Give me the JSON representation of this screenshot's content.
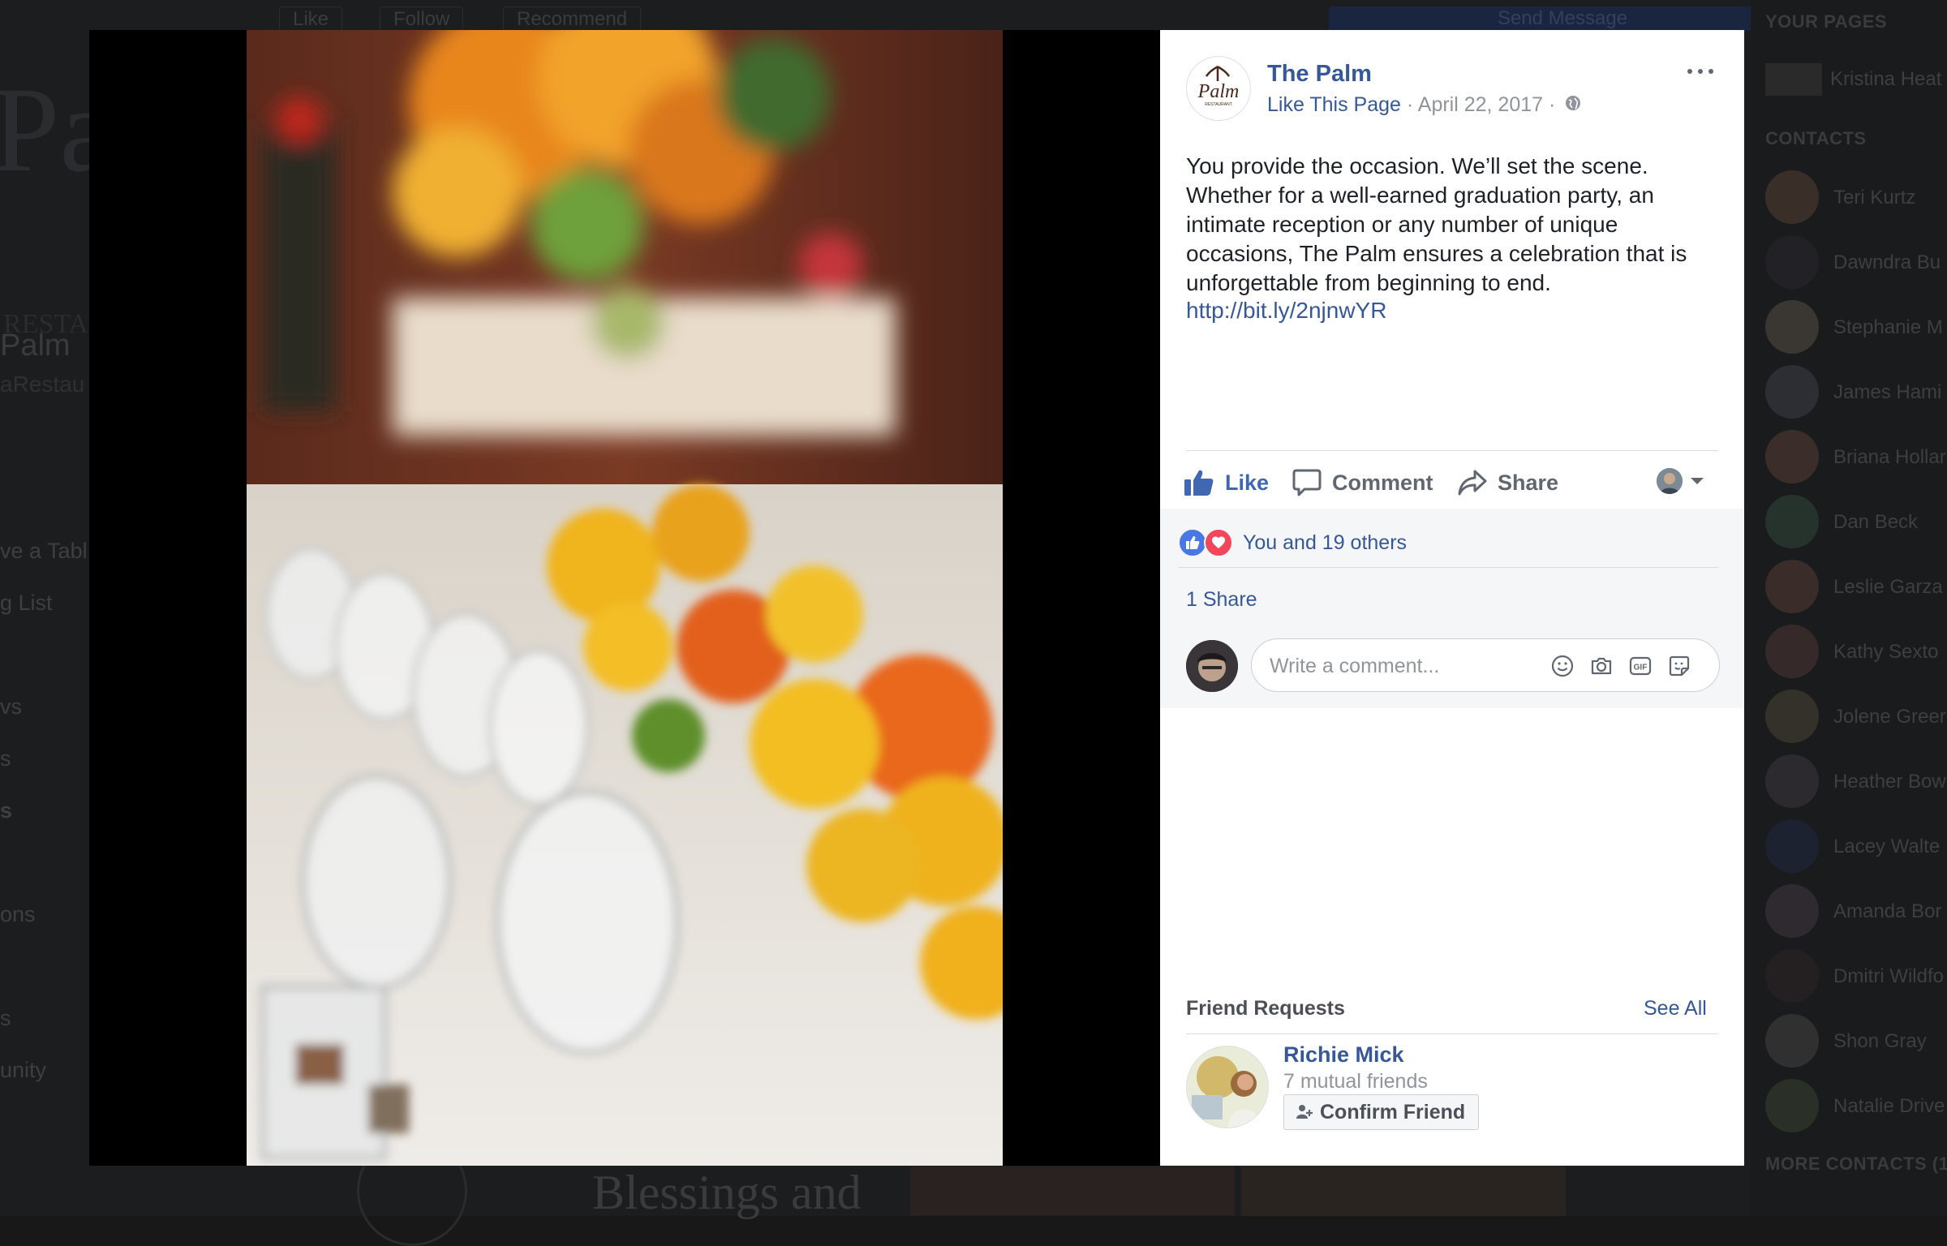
{
  "background": {
    "topbar": {
      "like": "Like",
      "follow": "Follow",
      "recommend": "Recommend",
      "send_message": "Send Message"
    },
    "page_name": "Palm",
    "page_handle": "aRestau",
    "nav": [
      {
        "label": "ve a Tabl",
        "bold": false
      },
      {
        "label": "g List",
        "bold": false
      },
      {
        "label": "vs",
        "bold": false
      },
      {
        "label": "s",
        "bold": false
      },
      {
        "label": "s",
        "bold": true
      },
      {
        "label": "ons",
        "bold": false
      },
      {
        "label": "s",
        "bold": false
      },
      {
        "label": "unity",
        "bold": false
      }
    ],
    "bottom_heading": "Blessings and"
  },
  "sidebar": {
    "your_pages_heading": "YOUR PAGES",
    "your_page_name": "Kristina Heat",
    "contacts_heading": "CONTACTS",
    "contacts": [
      "Teri Kurtz",
      "Dawndra Bu",
      "Stephanie M",
      "James Hami",
      "Briana Hollar",
      "Dan Beck",
      "Leslie Garza",
      "Kathy Sexto",
      "Jolene Greer",
      "Heather Bow",
      "Lacey Walte",
      "Amanda Bor",
      "Dmitri Wildfo",
      "Shon Gray",
      "Natalie Drive"
    ],
    "more_contacts_heading": "MORE CONTACTS (1"
  },
  "post": {
    "page_name": "The Palm",
    "logo_text": "Palm",
    "logo_subtext": "RESTAURANT",
    "like_page": "Like This Page",
    "separator": " · ",
    "date": "April 22, 2017",
    "body_lines": [
      "You provide the occasion. We’ll set the scene.",
      "Whether for a well-earned graduation party, an",
      "intimate reception or any number of unique",
      "occasions, The Palm ensures a celebration that is",
      "unforgettable from beginning to end."
    ],
    "link": "http://bit.ly/2njnwYR",
    "actions": {
      "like": "Like",
      "comment": "Comment",
      "share": "Share"
    },
    "reactions_text": "You and 19 others",
    "shares_text": "1 Share",
    "comment_placeholder": "Write a comment...",
    "gif_label": "GIF"
  },
  "friend_requests": {
    "title": "Friend Requests",
    "see_all": "See All",
    "name": "Richie Mick",
    "mutual": "7 mutual friends",
    "confirm": "Confirm Friend"
  },
  "colors": {
    "link_blue": "#365899",
    "like_blue": "#4267b2",
    "love_red": "#f2475a",
    "panel_bg": "#ffffff",
    "reactions_bg": "#f5f6f7"
  },
  "icons": {
    "like": "thumbs-up-icon",
    "comment": "speech-bubble-icon",
    "share": "share-arrow-icon",
    "more": "ellipsis-icon",
    "globe": "globe-icon",
    "emoji": "smiley-icon",
    "camera": "camera-icon",
    "gif": "gif-icon",
    "sticker": "sticker-icon",
    "friend": "add-friend-icon"
  }
}
